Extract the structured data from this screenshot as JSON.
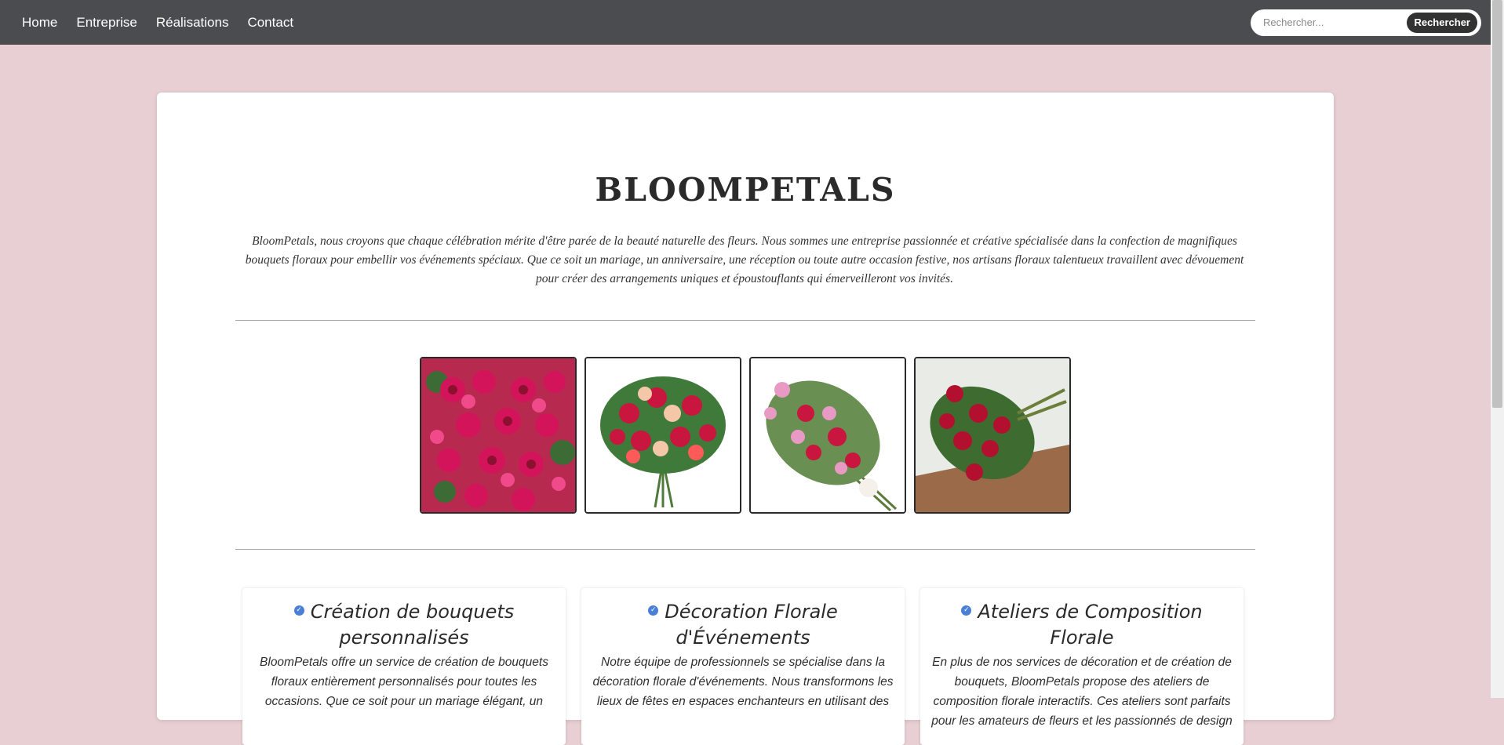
{
  "nav": {
    "items": [
      "Home",
      "Entreprise",
      "Réalisations",
      "Contact"
    ]
  },
  "search": {
    "placeholder": "Rechercher...",
    "button_label": "Rechercher"
  },
  "hero": {
    "title": "BLOOMPETALS",
    "intro": "BloomPetals, nous croyons que chaque célébration mérite d'être parée de la beauté naturelle des fleurs. Nous sommes une entreprise passionnée et créative spécialisée dans la confection de magnifiques bouquets floraux pour embellir vos événements spéciaux. Que ce soit un mariage, un anniversaire, une réception ou toute autre occasion festive, nos artisans floraux talentueux travaillent avec dévouement pour créer des arrangements uniques et époustouflants qui émerveilleront vos invités."
  },
  "gallery": {
    "images": [
      "bouquet-photo-1",
      "bouquet-photo-2",
      "bouquet-photo-3",
      "bouquet-photo-4"
    ]
  },
  "services": [
    {
      "title": "Création de bouquets personnalisés",
      "text": "BloomPetals offre un service de création de bouquets floraux entièrement personnalisés pour toutes les occasions. Que ce soit pour un mariage élégant, un"
    },
    {
      "title": "Décoration Florale d'Événements",
      "text": "Notre équipe de professionnels se spécialise dans la décoration florale d'événements. Nous transformons les lieux de fêtes en espaces enchanteurs en utilisant des"
    },
    {
      "title": "Ateliers de Composition Florale",
      "text": "En plus de nos services de décoration et de création de bouquets, BloomPetals propose des ateliers de composition florale interactifs. Ces ateliers sont parfaits pour les amateurs de fleurs et les passionnés de design"
    }
  ],
  "colors": {
    "page_background": "#e7cfd3",
    "topbar": "#4b4c50",
    "check_icon": "#4a7fd6"
  }
}
